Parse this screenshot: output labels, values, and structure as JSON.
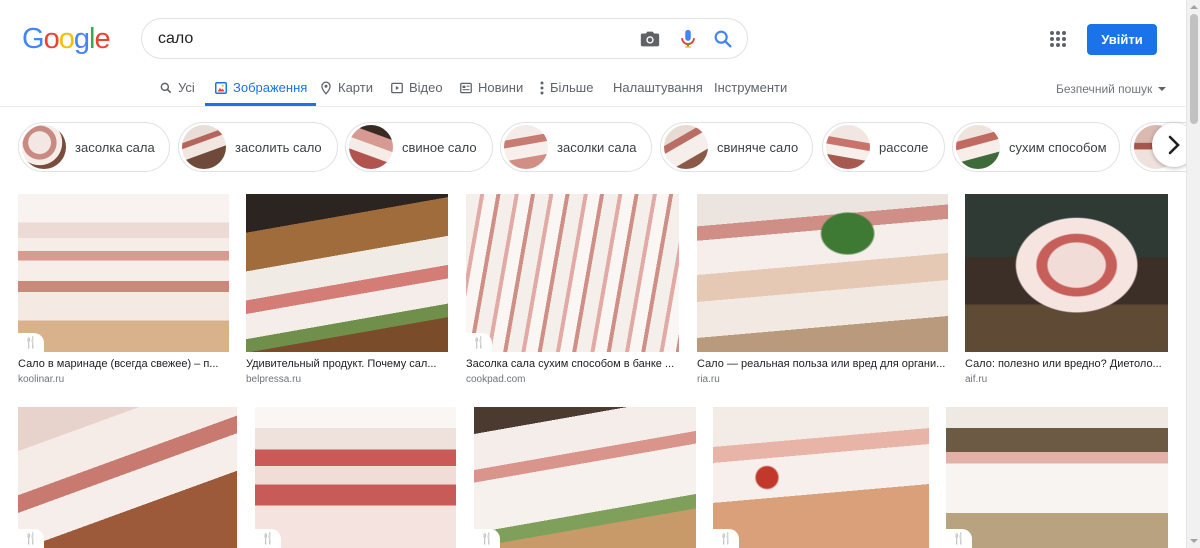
{
  "logo": {
    "text": "Google",
    "letters": [
      "G",
      "o",
      "o",
      "g",
      "l",
      "e"
    ],
    "colors": [
      "#4285f4",
      "#ea4335",
      "#fbbc05",
      "#4285f4",
      "#34a853",
      "#ea4335"
    ]
  },
  "search": {
    "query": "сало"
  },
  "header": {
    "login_label": "Увійти"
  },
  "tabs": [
    {
      "label": "Усі",
      "icon": "search-icon"
    },
    {
      "label": "Зображення",
      "icon": "image-icon",
      "active": true
    },
    {
      "label": "Карти",
      "icon": "map-pin-icon"
    },
    {
      "label": "Відео",
      "icon": "video-icon"
    },
    {
      "label": "Новини",
      "icon": "news-icon"
    },
    {
      "label": "Більше",
      "icon": "more-vert-icon"
    },
    {
      "label": "Налаштування"
    },
    {
      "label": "Інструменти"
    }
  ],
  "safesearch": {
    "label": "Безпечний пошук"
  },
  "chips": [
    {
      "label": "засолка сала"
    },
    {
      "label": "засолить сало"
    },
    {
      "label": "свиное сало"
    },
    {
      "label": "засолки сала"
    },
    {
      "label": "свиняче сало"
    },
    {
      "label": "рассоле"
    },
    {
      "label": "сухим способом"
    },
    {
      "label": ""
    }
  ],
  "results": [
    {
      "caption": "Сало в маринаде (всегда свежее) – п...",
      "source": "koolinar.ru",
      "recipe": true
    },
    {
      "caption": "Удивительный продукт. Почему сал...",
      "source": "belpressa.ru",
      "recipe": false
    },
    {
      "caption": "Засолка сала сухим способом в банке ...",
      "source": "cookpad.com",
      "recipe": true
    },
    {
      "caption": "Сало — реальная польза или вред для органи...",
      "source": "ria.ru",
      "recipe": false
    },
    {
      "caption": "Сало: полезно или вредно? Диетоло...",
      "source": "aif.ru",
      "recipe": false
    },
    {
      "caption": "",
      "source": "",
      "recipe": true
    },
    {
      "caption": "",
      "source": "",
      "recipe": true
    },
    {
      "caption": "",
      "source": "",
      "recipe": true
    },
    {
      "caption": "",
      "source": "",
      "recipe": true
    },
    {
      "caption": "",
      "source": "",
      "recipe": true
    }
  ],
  "colors": {
    "accent": "#1a73e8",
    "text_secondary": "#5f6368",
    "border": "#dfe1e5"
  }
}
